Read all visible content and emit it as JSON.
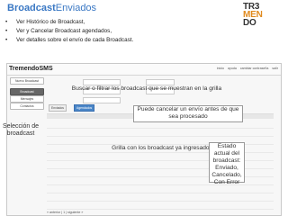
{
  "slide": {
    "title_part1": "Broadcast",
    "title_part2": "Enviados",
    "bullets": [
      "Ver Histórico de Broadcast,",
      "Ver y Cancelar Broadcast agendados,",
      "Ver detalles sobre el envío de cada Broadcast."
    ],
    "logo_lines": [
      "TR3",
      "MEN",
      "DO"
    ]
  },
  "app": {
    "brand": "TremendoSMS",
    "topnav": [
      "inicio",
      "ayuda",
      "cambiar contraseña",
      "salir"
    ],
    "sidebar": [
      {
        "label": "Nuevo Broadcast",
        "active": false
      },
      {
        "label": "Broadcast",
        "active": true
      },
      {
        "label": "Mensajes",
        "active": false
      },
      {
        "label": "Contactos",
        "active": false
      }
    ],
    "tabs": [
      "Enviados",
      "Agendados"
    ],
    "pager": "« anterior | 1 | siguiente »"
  },
  "callouts": {
    "filter": "Buscar o filtrar los broadcast que se muestran en la grilla",
    "cancel": "Puede cancelar un envío antes de que sea procesado",
    "selection": "Selección de broadcast",
    "grid": "Grilla con los broadcast ya ingresados",
    "status": "Estado actual del broadcast: Enviado, Cancelado, Con Error"
  },
  "colors": {
    "title": "#3a78c4",
    "logo_accent": "#e08a1e",
    "active_tab": "#4a86c8"
  }
}
